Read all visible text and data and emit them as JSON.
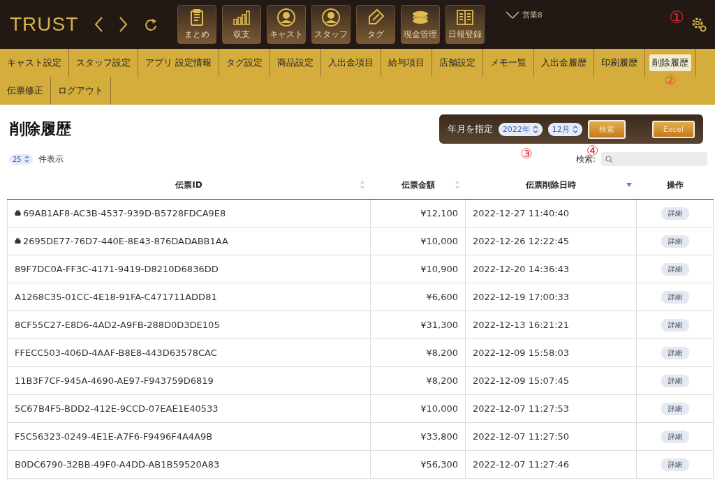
{
  "header": {
    "logo": "TRUST",
    "toolbar": [
      {
        "label": "まとめ",
        "kind": "clipboard"
      },
      {
        "label": "収支",
        "kind": "bars"
      },
      {
        "label": "キャスト",
        "kind": "woman"
      },
      {
        "label": "スタッフ",
        "kind": "man"
      },
      {
        "label": "タグ",
        "kind": "tag"
      },
      {
        "label": "現金管理",
        "kind": "money"
      },
      {
        "label": "日報登録",
        "kind": "book"
      }
    ],
    "store": "営業8",
    "annotation": "①"
  },
  "nav": {
    "tabs": [
      {
        "label": "キャスト設定",
        "selected": false
      },
      {
        "label": "スタッフ設定",
        "selected": false
      },
      {
        "label": "アプリ 設定情報",
        "selected": false
      },
      {
        "label": "タグ設定",
        "selected": false
      },
      {
        "label": "商品設定",
        "selected": false
      },
      {
        "label": "入出金項目",
        "selected": false
      },
      {
        "label": "給与項目",
        "selected": false
      },
      {
        "label": "店舗設定",
        "selected": false
      },
      {
        "label": "メモ一覧",
        "selected": false
      },
      {
        "label": "入出金履歴",
        "selected": false
      },
      {
        "label": "印刷履歴",
        "selected": false
      },
      {
        "label": "削除履歴",
        "selected": true
      },
      {
        "label": "伝票修正",
        "selected": false
      },
      {
        "label": "ログアウト",
        "selected": false
      }
    ],
    "annotation": "②"
  },
  "page": {
    "title": "削除履歴",
    "filter": {
      "label": "年月を指定",
      "year": "2022年",
      "month": "12月",
      "search_button": "検索",
      "excel_button": "Excel"
    },
    "page_size": "25",
    "page_size_label": "件表示",
    "search_label": "検索:",
    "annotations": [
      "③",
      "④"
    ]
  },
  "table": {
    "columns": [
      {
        "label": "伝票ID",
        "sortable": true,
        "sorted_desc": false
      },
      {
        "label": "伝票金額",
        "sortable": true,
        "sorted_desc": false
      },
      {
        "label": "伝票削除日時",
        "sortable": true,
        "sorted_desc": true
      },
      {
        "label": "操作",
        "sortable": false
      }
    ],
    "rows": [
      {
        "id": "69AB1AF8-AC3B-4537-939D-B5728FDCA9E8",
        "printed": true,
        "amount": "¥12,100",
        "deleted_at": "2022-12-27 11:40:40",
        "action": "詳細"
      },
      {
        "id": "2695DE77-76D7-440E-8E43-876DADABB1AA",
        "printed": true,
        "amount": "¥10,000",
        "deleted_at": "2022-12-26 12:22:45",
        "action": "詳細"
      },
      {
        "id": "89F7DC0A-FF3C-4171-9419-D8210D6836DD",
        "printed": false,
        "amount": "¥10,900",
        "deleted_at": "2022-12-20 14:36:43",
        "action": "詳細"
      },
      {
        "id": "A1268C35-01CC-4E18-91FA-C471711ADD81",
        "printed": false,
        "amount": "¥6,600",
        "deleted_at": "2022-12-19 17:00:33",
        "action": "詳細"
      },
      {
        "id": "8CF55C27-E8D6-4AD2-A9FB-288D0D3DE105",
        "printed": false,
        "amount": "¥31,300",
        "deleted_at": "2022-12-13 16:21:21",
        "action": "詳細"
      },
      {
        "id": "FFECC503-406D-4AAF-B8E8-443D63578CAC",
        "printed": false,
        "amount": "¥8,200",
        "deleted_at": "2022-12-09 15:58:03",
        "action": "詳細"
      },
      {
        "id": "11B3F7CF-945A-4690-AE97-F943759D6819",
        "printed": false,
        "amount": "¥8,200",
        "deleted_at": "2022-12-09 15:07:45",
        "action": "詳細"
      },
      {
        "id": "5C67B4F5-BDD2-412E-9CCD-07EAE1E40533",
        "printed": false,
        "amount": "¥10,000",
        "deleted_at": "2022-12-07 11:27:53",
        "action": "詳細"
      },
      {
        "id": "F5C56323-0249-4E1E-A7F6-F9496F4A4A9B",
        "printed": false,
        "amount": "¥33,800",
        "deleted_at": "2022-12-07 11:27:50",
        "action": "詳細"
      },
      {
        "id": "B0DC6790-32BB-49F0-A4DD-AB1B59520A83",
        "printed": false,
        "amount": "¥56,300",
        "deleted_at": "2022-12-07 11:27:46",
        "action": "詳細"
      }
    ]
  }
}
